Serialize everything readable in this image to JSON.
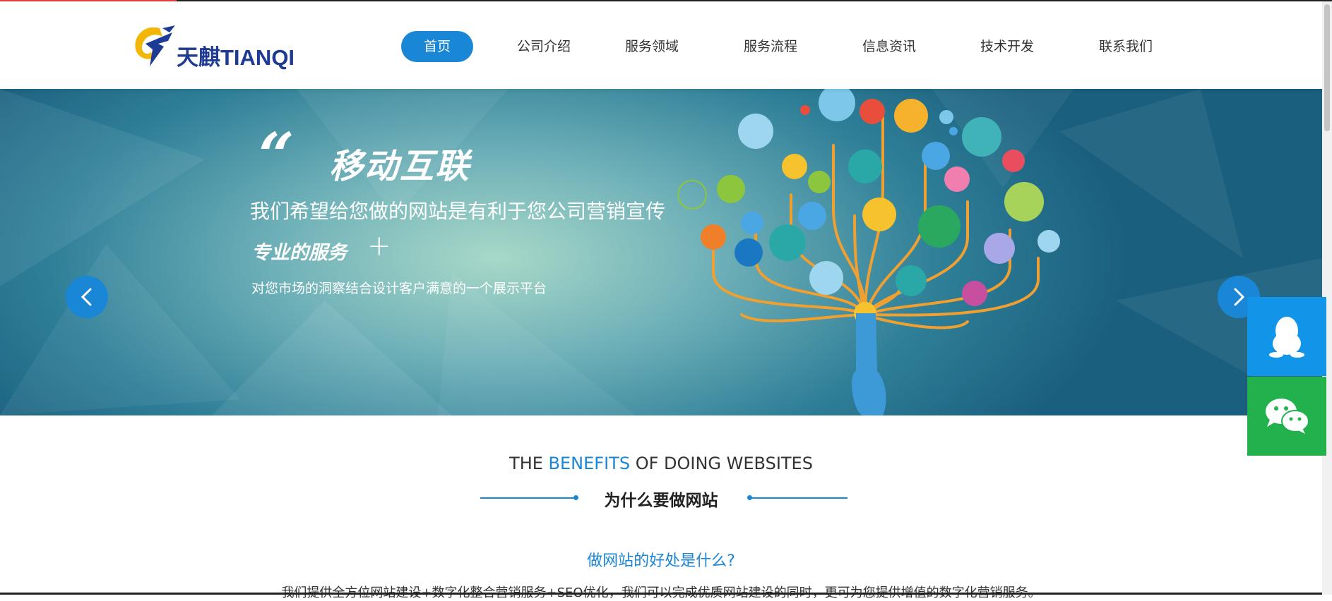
{
  "logo": {
    "text": "天麒TIANQI"
  },
  "nav": {
    "items": [
      "首页",
      "公司介绍",
      "服务领域",
      "服务流程",
      "信息资讯",
      "技术开发",
      "联系我们"
    ],
    "active": "首页"
  },
  "banner": {
    "quote_mark": "“",
    "title": "移动互联",
    "subtitle": "我们希望给您做的网站是有利于您公司营销宣传",
    "service": "专业的服务",
    "plus": "+",
    "description": "对您市场的洞察结合设计客户满意的一个展示平台"
  },
  "benefits": {
    "en_prefix": "THE ",
    "en_highlight": "BENEFITS",
    "en_suffix": " OF DOING WEBSITES",
    "cn_title": "为什么要做网站",
    "question": "做网站的好处是什么?",
    "description": "我们提供全方位网站建设+数字化整合营销服务+SEO优化，我们可以完成优质网站建设的同时，更可为您提供增值的数字化营销服务。"
  },
  "side_float": {
    "qq_icon": "qq-penguin-icon",
    "wechat_icon": "wechat-icon"
  },
  "colors": {
    "accent": "#1a86d6",
    "qq": "#1295e8",
    "wechat": "#22b14c"
  }
}
